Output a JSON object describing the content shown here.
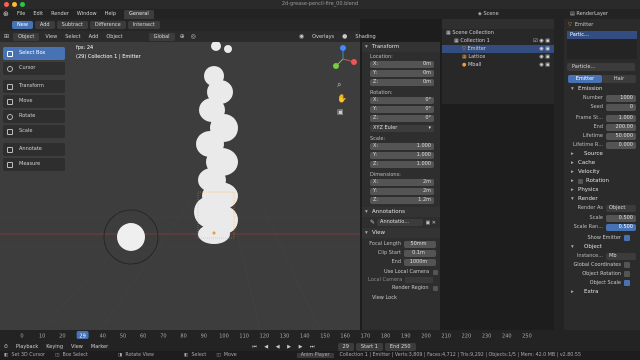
{
  "window": {
    "title": "2d-grease-pencil-fire_00.blend"
  },
  "menu": {
    "items": [
      "File",
      "Edit",
      "Render",
      "Window",
      "Help"
    ],
    "workspace_tab": "General"
  },
  "scene": {
    "label": "Scene",
    "view_layer": "RenderLayer"
  },
  "tool_header": {
    "buttons": [
      "New",
      "Add",
      "Subtract",
      "Difference",
      "Intersect"
    ]
  },
  "view_header": {
    "mode": "Object Mode",
    "menus": [
      "View",
      "Select",
      "Add",
      "Object"
    ],
    "orientation": "Global",
    "overlays": "Overlays",
    "shading": "Shading"
  },
  "toolbar": {
    "tools": [
      {
        "label": "Select Box",
        "active": true
      },
      {
        "label": "Cursor"
      },
      {
        "label": "Transform"
      },
      {
        "label": "Move"
      },
      {
        "label": "Rotate"
      },
      {
        "label": "Scale"
      },
      {
        "label": "Annotate"
      },
      {
        "label": "Measure"
      }
    ]
  },
  "viewport": {
    "fps": "fps: 24",
    "info": "(29) Collection 1 | Emitter"
  },
  "npanel": {
    "transform_title": "Transform",
    "location_label": "Location:",
    "location": [
      {
        "axis": "X:",
        "value": "0m"
      },
      {
        "axis": "Y:",
        "value": "0m"
      },
      {
        "axis": "Z:",
        "value": "0m"
      }
    ],
    "rotation_label": "Rotation:",
    "rotation": [
      {
        "axis": "X:",
        "value": "0°"
      },
      {
        "axis": "Y:",
        "value": "0°"
      },
      {
        "axis": "Z:",
        "value": "0°"
      }
    ],
    "rotation_mode": "XYZ Euler",
    "scale_label": "Scale:",
    "scale": [
      {
        "axis": "X:",
        "value": "1.000"
      },
      {
        "axis": "Y:",
        "value": "1.000"
      },
      {
        "axis": "Z:",
        "value": "1.000"
      }
    ],
    "dimensions_label": "Dimensions:",
    "dimensions": [
      {
        "axis": "X:",
        "value": "2m"
      },
      {
        "axis": "Y:",
        "value": "2m"
      },
      {
        "axis": "Z:",
        "value": "1.2m"
      }
    ],
    "annotations_title": "Annotations",
    "annotation_layer": "Annotatio...",
    "view_title": "View",
    "focal_length_label": "Focal Length",
    "focal_length": "50mm",
    "clip_start_label": "Clip Start",
    "clip_start": "0.1m",
    "clip_end_label": "End",
    "clip_end": "1000m",
    "use_local_camera": "Use Local Camera",
    "local_camera": "Local Camera",
    "render_region": "Render Region",
    "view_lock": "View Lock"
  },
  "outliner": {
    "rows": [
      {
        "label": "Scene Collection",
        "indent": 0
      },
      {
        "label": "Collection 1",
        "indent": 1
      },
      {
        "label": "Emitter",
        "indent": 2,
        "selected": true
      },
      {
        "label": "Lattice",
        "indent": 2
      },
      {
        "label": "Mball",
        "indent": 2
      }
    ]
  },
  "properties": {
    "object_name": "Emitter",
    "particle_system": "Partic...",
    "settings_name": "Particle...",
    "tabs": [
      "Emitter",
      "Hair"
    ],
    "emission_title": "Emission",
    "emission": [
      {
        "label": "Number",
        "value": "1000"
      },
      {
        "label": "Seed",
        "value": "0"
      },
      {
        "label": "Frame St...",
        "value": "1.000"
      },
      {
        "label": "End",
        "value": "200.00"
      },
      {
        "label": "Lifetime",
        "value": "50.000"
      },
      {
        "label": "Lifetime R...",
        "value": "0.000"
      }
    ],
    "sections": [
      "Source",
      "Cache",
      "Velocity",
      "Rotation",
      "Physics",
      "Render"
    ],
    "render_as_label": "Render As",
    "render_as": "Object",
    "render_scale_label": "Scale",
    "render_scale": "0.500",
    "scale_random_label": "Scale Ran...",
    "scale_random": "0.500",
    "show_emitter": "Show Emitter",
    "object_title": "Object",
    "instance_label": "Instance...",
    "instance_value": "Mb",
    "global_coordinates": "Global Coordinates",
    "object_rotation": "Object Rotation",
    "object_scale": "Object Scale",
    "extra": "Extra"
  },
  "timeline": {
    "menus": [
      "Playback",
      "Keying",
      "View",
      "Marker"
    ],
    "ticks": [
      "0",
      "10",
      "20",
      "29",
      "40",
      "50",
      "60",
      "70",
      "80",
      "90",
      "100",
      "110",
      "120",
      "130",
      "140",
      "150",
      "160",
      "170",
      "180",
      "190",
      "200",
      "210",
      "220",
      "230",
      "240",
      "250"
    ],
    "current_frame": "29",
    "start_label": "Start",
    "start": "1",
    "end_label": "End",
    "end": "250"
  },
  "statusbar": {
    "items": [
      "Set 3D Cursor",
      "Box Select",
      "Rotate View",
      "Select",
      "Move",
      "Anim Player"
    ],
    "info": "Collection 1 | Emitter | Verts:3,809 | Faces:4,712 | Tris:9,292 | Objects:1/5 | Mem: 42.0 MB | v2.80.55"
  },
  "colors": {
    "accent": "#4772b3",
    "active_orange": "#e89e3b",
    "background": "#3d3d3d"
  }
}
